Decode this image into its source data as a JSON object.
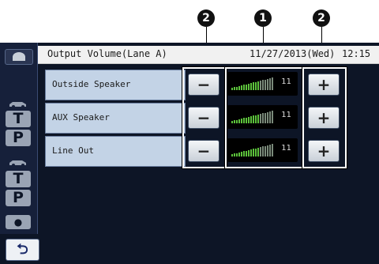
{
  "callouts": {
    "left": "2",
    "center": "1",
    "right": "2"
  },
  "header": {
    "title": "Output Volume(Lane A)",
    "date": "11/27/2013(Wed)",
    "time": "12:15"
  },
  "sidebar": {
    "letters": [
      "T",
      "P",
      "T",
      "P"
    ],
    "icons": [
      "camera-icon",
      "car-icon",
      "car-icon",
      "dot-icon"
    ]
  },
  "rows": [
    {
      "label": "Outside Speaker",
      "value": "11",
      "level": 1.0
    },
    {
      "label": "AUX Speaker",
      "value": "11",
      "level": 1.0
    },
    {
      "label": "Line Out",
      "value": "11",
      "level": 1.0
    }
  ],
  "buttons": {
    "minus": "−",
    "plus": "+",
    "back": "⮌"
  },
  "colors": {
    "screen_bg": "#0d1526",
    "label_bg": "#c3d3e6",
    "meter_on": "#5cc23b",
    "meter_off": "#7a8a7a"
  }
}
